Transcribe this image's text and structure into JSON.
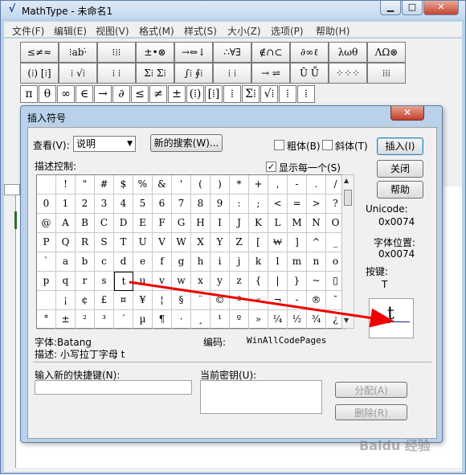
{
  "window": {
    "title": "MathType - 未命名1",
    "min_label": "▁",
    "max_label": "□",
    "close_label": "✕"
  },
  "menu": [
    "文件(F)",
    "编辑(E)",
    "视图(V)",
    "格式(M)",
    "样式(S)",
    "大小(Z)",
    "选项(P)",
    "帮助(H)"
  ],
  "toolbar": {
    "row1": [
      "≤≠≈",
      "⁝ab·̇",
      "⁝⁞⁝",
      "±•⊗",
      "→⇔↓",
      "∴∀∃",
      "∉∩⊂",
      "∂∞ℓ",
      "λωθ",
      "ΛΩ⊛"
    ],
    "row2": [
      "(⁞) [⁞]",
      "⁞ √⁞",
      "⁞ ⁞",
      "Σ⁞ Σ⁞",
      "∫⁞ ∮⁞",
      "⁞ ⁞",
      "→ ⇌",
      "Ū Ṻ",
      "⁘⁘⁘",
      "⁞⁞⁞"
    ],
    "row3": [
      "π",
      "θ",
      "∞",
      "∈",
      "→",
      "∂",
      "≤",
      "≠",
      "±",
      "(⁞)",
      "[⁞]",
      "⁞",
      "Σ⁞",
      "√⁞",
      "⁞",
      "⁞"
    ]
  },
  "dialog": {
    "title": "插入符号",
    "close_label": "✕",
    "view_label": "查看(V):",
    "view_value": "说明",
    "new_search_button": "新的搜索(W)...",
    "bold_label": "粗体(B)",
    "italic_label": "斜体(T)",
    "insert_button": "插入(I)",
    "close_button": "关闭",
    "help_button": "帮助",
    "desc_label": "描述控制:",
    "show_each_label": "显示每一个(S)",
    "show_each_checked": true,
    "unicode_label": "Unicode:",
    "unicode_value": "0x0074",
    "font_pos_label": "字体位置:",
    "font_pos_value": "0x0074",
    "key_label": "按键:",
    "key_value": "T",
    "preview_char": "t",
    "font_info": "字体:Batang",
    "encoding_label": "编码:",
    "encoding_value": "WinAllCodePages",
    "description_info": "描述: 小写拉丁字母 t",
    "shortcut_label": "输入新的快捷键(N):",
    "shortcut_value": "",
    "current_key_label": "当前密钥(U):",
    "assign_button": "分配(A)",
    "delete_button": "删除(R)"
  },
  "symbol_grid": [
    [
      " ",
      "!",
      "\"",
      "#",
      "$",
      "%",
      "&",
      "'",
      "(",
      ")",
      "*",
      "+",
      ",",
      "-",
      ".",
      "/"
    ],
    [
      "0",
      "1",
      "2",
      "3",
      "4",
      "5",
      "6",
      "7",
      "8",
      "9",
      ":",
      ";",
      "<",
      "=",
      ">",
      "?"
    ],
    [
      "@",
      "A",
      "B",
      "C",
      "D",
      "E",
      "F",
      "G",
      "H",
      "I",
      "J",
      "K",
      "L",
      "M",
      "N",
      "O"
    ],
    [
      "P",
      "Q",
      "R",
      "S",
      "T",
      "U",
      "V",
      "W",
      "X",
      "Y",
      "Z",
      "[",
      "₩",
      "]",
      "^",
      "_"
    ],
    [
      "`",
      "a",
      "b",
      "c",
      "d",
      "e",
      "f",
      "g",
      "h",
      "i",
      "j",
      "k",
      "l",
      "m",
      "n",
      "o"
    ],
    [
      "p",
      "q",
      "r",
      "s",
      "t",
      "u",
      "v",
      "w",
      "x",
      "y",
      "z",
      "{",
      "|",
      "}",
      "~",
      "▯"
    ],
    [
      " ",
      "¡",
      "¢",
      "£",
      "¤",
      "¥",
      "¦",
      "§",
      "¨",
      "©",
      "ª",
      "«",
      "¬",
      "-",
      "®",
      "¯"
    ],
    [
      "°",
      "±",
      "²",
      "³",
      "´",
      "µ",
      "¶",
      "·",
      "¸",
      "¹",
      "º",
      "»",
      "¼",
      "½",
      "¾",
      "¿"
    ]
  ],
  "selected_symbol": "t",
  "watermark": "Baidu 经验"
}
